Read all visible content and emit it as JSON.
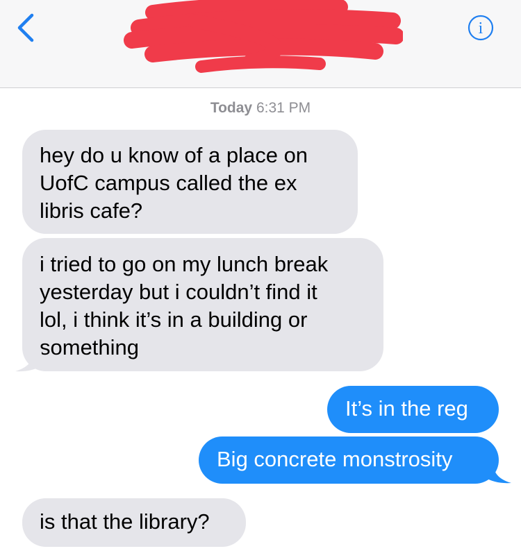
{
  "header": {
    "back_icon": "chevron-left-icon",
    "info_icon": "info-circle-icon",
    "info_glyph": "i",
    "accent_color": "#1f7ff0"
  },
  "conversation": {
    "timestamp_day": "Today",
    "timestamp_time": "6:31 PM",
    "messages": [
      {
        "direction": "received",
        "text": "hey do u know of a place on\nUofC campus called the ex\nlibris cafe?"
      },
      {
        "direction": "received",
        "text": "i tried to go on my lunch break\nyesterday but i couldn’t find it\nlol, i think it’s in a building or\nsomething"
      },
      {
        "direction": "sent",
        "text": "It’s in the reg"
      },
      {
        "direction": "sent",
        "text": "Big concrete monstrosity"
      },
      {
        "direction": "received",
        "text": "is that the library?"
      }
    ]
  },
  "colors": {
    "received_bubble": "#e5e5ea",
    "sent_bubble": "#1f8efa",
    "redaction": "#f03b4a",
    "timestamp": "#8e8e93"
  }
}
